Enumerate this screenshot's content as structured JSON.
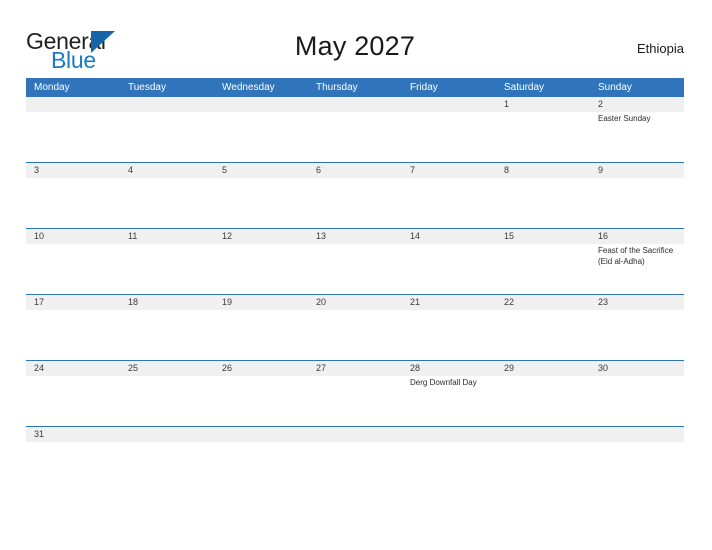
{
  "brand": {
    "name_top": "General",
    "name_bottom": "Blue"
  },
  "header": {
    "title": "May 2027",
    "country": "Ethiopia"
  },
  "calendar": {
    "weekday_headers": [
      "Monday",
      "Tuesday",
      "Wednesday",
      "Thursday",
      "Friday",
      "Saturday",
      "Sunday"
    ],
    "colors": {
      "header_blue": "#3075bc",
      "divider_blue": "#2e75b6",
      "date_band_gray": "#f0f0f0",
      "brand_blue": "#1a7bc4",
      "text_dark": "#1a1a1a"
    },
    "weeks": [
      {
        "days": [
          {
            "num": "",
            "events": []
          },
          {
            "num": "",
            "events": []
          },
          {
            "num": "",
            "events": []
          },
          {
            "num": "",
            "events": []
          },
          {
            "num": "",
            "events": []
          },
          {
            "num": "1",
            "events": []
          },
          {
            "num": "2",
            "events": [
              "Easter Sunday"
            ]
          }
        ]
      },
      {
        "days": [
          {
            "num": "3",
            "events": []
          },
          {
            "num": "4",
            "events": []
          },
          {
            "num": "5",
            "events": []
          },
          {
            "num": "6",
            "events": []
          },
          {
            "num": "7",
            "events": []
          },
          {
            "num": "8",
            "events": []
          },
          {
            "num": "9",
            "events": []
          }
        ]
      },
      {
        "days": [
          {
            "num": "10",
            "events": []
          },
          {
            "num": "11",
            "events": []
          },
          {
            "num": "12",
            "events": []
          },
          {
            "num": "13",
            "events": []
          },
          {
            "num": "14",
            "events": []
          },
          {
            "num": "15",
            "events": []
          },
          {
            "num": "16",
            "events": [
              "Feast of the Sacrifice (Eid al-Adha)"
            ]
          }
        ]
      },
      {
        "days": [
          {
            "num": "17",
            "events": []
          },
          {
            "num": "18",
            "events": []
          },
          {
            "num": "19",
            "events": []
          },
          {
            "num": "20",
            "events": []
          },
          {
            "num": "21",
            "events": []
          },
          {
            "num": "22",
            "events": []
          },
          {
            "num": "23",
            "events": []
          }
        ]
      },
      {
        "days": [
          {
            "num": "24",
            "events": []
          },
          {
            "num": "25",
            "events": []
          },
          {
            "num": "26",
            "events": []
          },
          {
            "num": "27",
            "events": []
          },
          {
            "num": "28",
            "events": [
              "Derg Downfall Day"
            ]
          },
          {
            "num": "29",
            "events": []
          },
          {
            "num": "30",
            "events": []
          }
        ]
      },
      {
        "days": [
          {
            "num": "31",
            "events": []
          },
          {
            "num": "",
            "events": []
          },
          {
            "num": "",
            "events": []
          },
          {
            "num": "",
            "events": []
          },
          {
            "num": "",
            "events": []
          },
          {
            "num": "",
            "events": []
          },
          {
            "num": "",
            "events": []
          }
        ]
      }
    ]
  }
}
